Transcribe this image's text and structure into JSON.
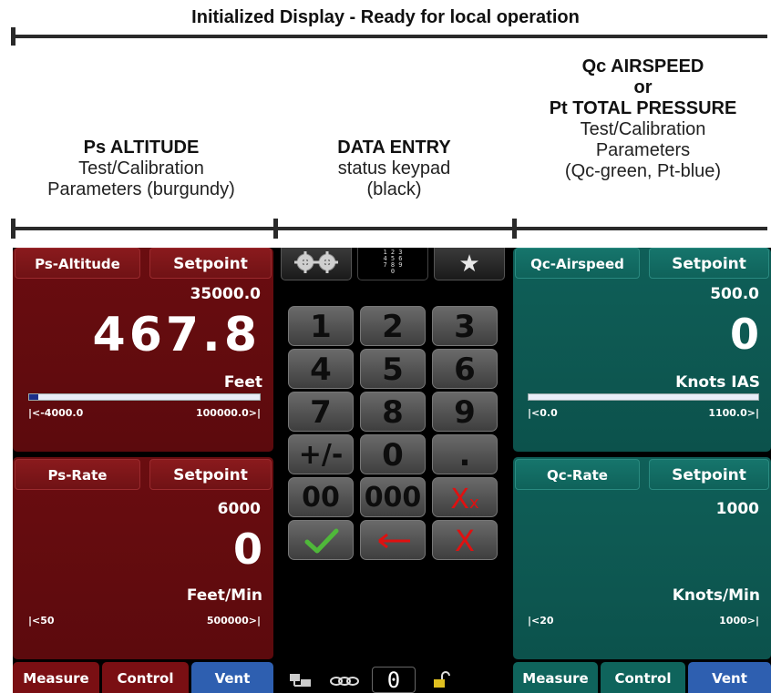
{
  "header": {
    "title": "Initialized Display - Ready for local operation"
  },
  "captions": {
    "ps_title": "Ps ALTITUDE",
    "ps_sub1": "Test/Calibration",
    "ps_sub2": "Parameters (burgundy)",
    "de_title": "DATA ENTRY",
    "de_sub1": "status keypad",
    "de_sub2": "(black)",
    "qc_title1": "Qc AIRSPEED",
    "qc_title2": "or",
    "qc_title3": "Pt TOTAL PRESSURE",
    "qc_sub1": "Test/Calibration",
    "qc_sub2": "Parameters",
    "qc_sub3": "(Qc-green, Pt-blue)"
  },
  "ps_altitude": {
    "name": "Ps-Altitude",
    "setpoint_label": "Setpoint",
    "setpoint_value": "35000.0",
    "reading": "467.8",
    "unit": "Feet",
    "range_min": "|<-4000.0",
    "range_max": "100000.0>|",
    "bar_fill_percent": 4
  },
  "ps_rate": {
    "name": "Ps-Rate",
    "setpoint_label": "Setpoint",
    "setpoint_value": "6000",
    "reading": "0",
    "unit": "Feet/Min",
    "range_min": "|<50",
    "range_max": "500000>|"
  },
  "qc_airspeed": {
    "name": "Qc-Airspeed",
    "setpoint_label": "Setpoint",
    "setpoint_value": "500.0",
    "reading": "0",
    "unit": "Knots IAS",
    "range_min": "|<0.0",
    "range_max": "1100.0>|",
    "bar_fill_percent": 0
  },
  "qc_rate": {
    "name": "Qc-Rate",
    "setpoint_label": "Setpoint",
    "setpoint_value": "1000",
    "reading": "",
    "unit": "Knots/Min",
    "range_min": "|<20",
    "range_max": "1000>|"
  },
  "keypad": {
    "top_icons": [
      "settings-gears-icon",
      "numeric-keypad-icon",
      "favorites-star-icon"
    ],
    "keys": [
      "1",
      "2",
      "3",
      "4",
      "5",
      "6",
      "7",
      "8",
      "9",
      "+/-",
      "0",
      ".",
      "00",
      "000"
    ],
    "clear_all": "X",
    "clear_all_sub": "x",
    "accept_icon": "checkmark-icon",
    "backspace_icon": "left-arrow-icon",
    "cancel": "X"
  },
  "left_tabs": [
    "Measure",
    "Control",
    "Vent"
  ],
  "right_tabs": [
    "Measure",
    "Control",
    "Vent"
  ],
  "status_bar": {
    "zero_label": "0",
    "icons": [
      "network-icon",
      "chain-link-icon",
      "unlock-icon"
    ]
  },
  "colors": {
    "burgundy": "#5c0a0d",
    "teal": "#0c524c",
    "vent_blue": "#2e5fb0",
    "keypad_bg": "#000000"
  }
}
